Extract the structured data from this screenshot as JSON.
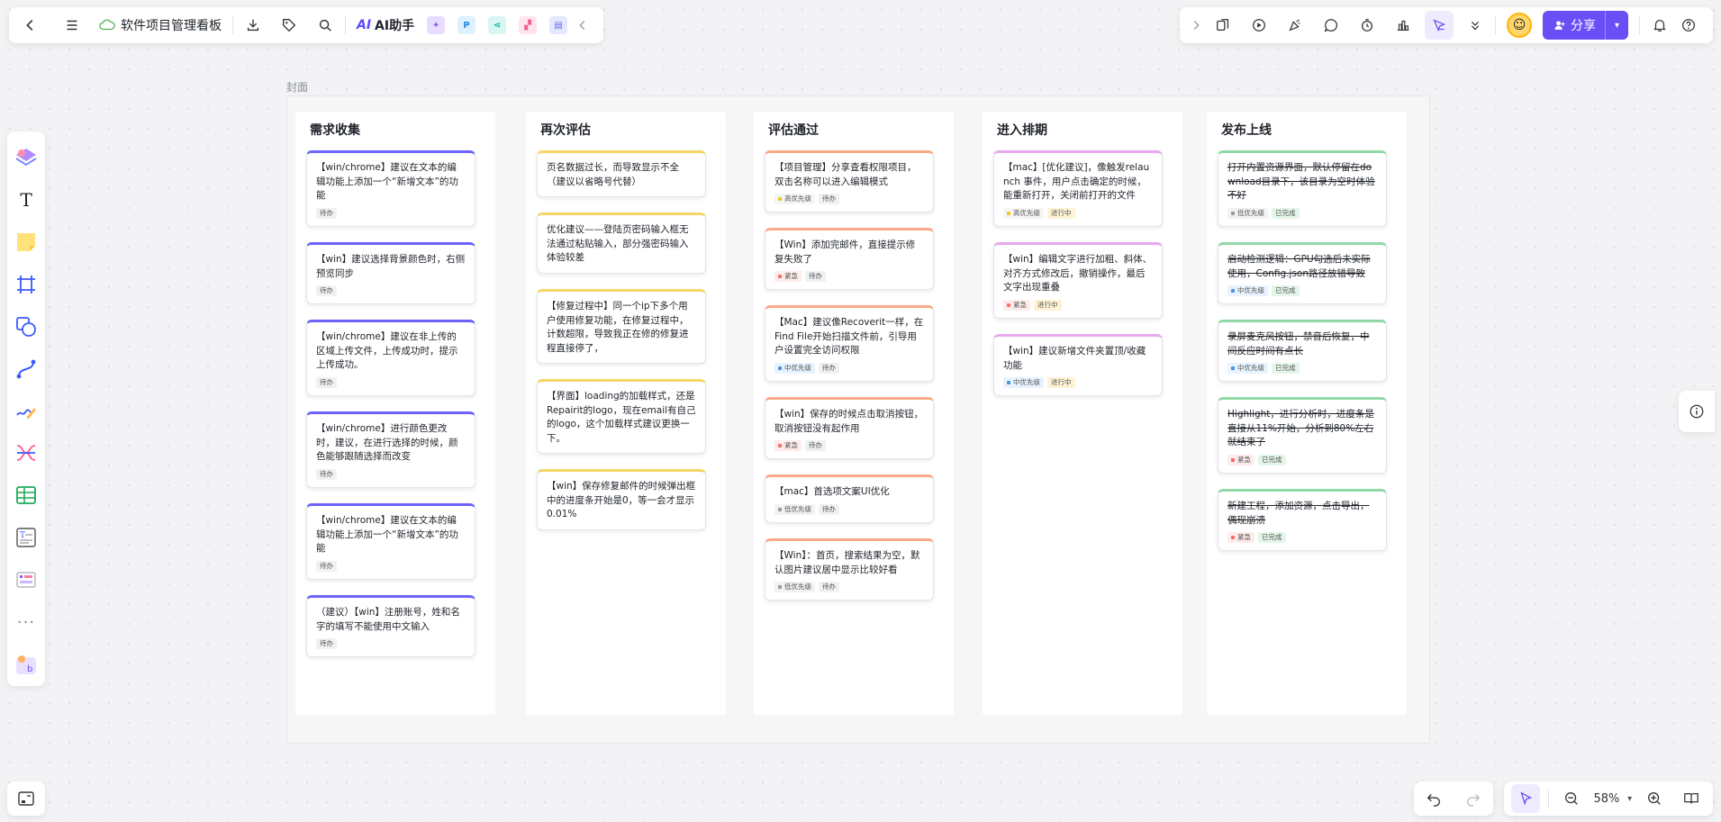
{
  "header": {
    "doc_title": "软件项目管理看板",
    "ai_label": "AI助手",
    "share_label": "分享"
  },
  "canvas": {
    "frame_label": "封面",
    "zoom": "58%"
  },
  "columns": [
    {
      "title": "需求收集",
      "color": "#6c63ff",
      "cards": [
        {
          "text": "【win/chrome】建议在文本的编辑功能上添加一个“新增文本”的功能",
          "tags": [
            {
              "label": "待办"
            }
          ]
        },
        {
          "text": "【win】建议选择背景颜色时，右侧预览同步",
          "tags": [
            {
              "label": "待办"
            }
          ]
        },
        {
          "text": "【win/chrome】建议在非上传的区域上传文件，上传成功时，提示上传成功。",
          "tags": [
            {
              "label": "待办"
            }
          ]
        },
        {
          "text": "【win/chrome】进行颜色更改时，建议，在进行选择的时候，颜色能够跟随选择而改变",
          "tags": [
            {
              "label": "待办"
            }
          ]
        },
        {
          "text": "【win/chrome】建议在文本的编辑功能上添加一个“新增文本”的功能",
          "tags": [
            {
              "label": "待办"
            }
          ]
        },
        {
          "text": "（建议）【win】注册账号，姓和名字的填写不能使用中文输入",
          "tags": [
            {
              "label": "待办"
            }
          ]
        }
      ]
    },
    {
      "title": "再次评估",
      "color": "#f5d565",
      "cards": [
        {
          "text": "页名数据过长，而导致显示不全（建议以省略号代替）",
          "tags": []
        },
        {
          "text": "优化建议——登陆页密码输入框无法通过粘贴输入，部分强密码输入体验较差",
          "tags": []
        },
        {
          "text": "【修复过程中】同一个ip下多个用户使用修复功能，在修复过程中，计数超限，导致我正在修的修复进程直接停了，",
          "tags": []
        },
        {
          "text": "【界面】loading的加载样式，还是Repairit的logo，现在email有自己的logo，这个加载样式建议更换一下。",
          "tags": []
        },
        {
          "text": "【win】保存修复邮件的时候弹出框中的进度条开始是0，等一会才显示0.01%",
          "tags": []
        }
      ]
    },
    {
      "title": "评估通过",
      "color": "#f9a98a",
      "cards": [
        {
          "text": "【项目管理】分享查看权限项目，双击名称可以进入编辑模式",
          "tags": [
            {
              "label": "高优先级",
              "dot": "#f5c518",
              "bg": "#f5f5f5"
            },
            {
              "label": "待办"
            }
          ]
        },
        {
          "text": "【Win】添加完邮件，直接提示修复失败了",
          "tags": [
            {
              "label": "紧急",
              "dot": "#f56c6c",
              "bg": "#fdecea"
            },
            {
              "label": "待办"
            }
          ]
        },
        {
          "text": "【Mac】建议像Recoverit一样，在Find File开始扫描文件前，引导用户设置完全访问权限",
          "tags": [
            {
              "label": "中优先级",
              "dot": "#4a90e2",
              "bg": "#e8f3ff"
            },
            {
              "label": "待办"
            }
          ]
        },
        {
          "text": "【win】保存的时候点击取消按钮，取消按钮没有起作用",
          "tags": [
            {
              "label": "紧急",
              "dot": "#f56c6c",
              "bg": "#fdecea"
            },
            {
              "label": "待办"
            }
          ]
        },
        {
          "text": "【mac】首选项文案UI优化",
          "tags": [
            {
              "label": "低优先级",
              "dot": "#999999",
              "bg": "#f2f2f2"
            },
            {
              "label": "待办"
            }
          ]
        },
        {
          "text": "【Win】：首页，搜索结果为空，默认图片建议居中显示比较好看",
          "tags": [
            {
              "label": "低优先级",
              "dot": "#999999",
              "bg": "#f2f2f2"
            },
            {
              "label": "待办"
            }
          ]
        }
      ]
    },
    {
      "title": "进入排期",
      "color": "#e8a8f0",
      "cards": [
        {
          "text": "【mac】[优化建议]，像触发relaunch 事件，用户点击确定的时候，能重新打开，关闭前打开的文件",
          "tags": [
            {
              "label": "高优先级",
              "dot": "#f5c518",
              "bg": "#f5f5f5"
            },
            {
              "label": "进行中",
              "bg": "#fff3d6"
            }
          ]
        },
        {
          "text": "【win】编辑文字进行加粗、斜体、对齐方式修改后，撤销操作，最后文字出现重叠",
          "tags": [
            {
              "label": "紧急",
              "dot": "#f56c6c",
              "bg": "#fdecea"
            },
            {
              "label": "进行中",
              "bg": "#fff3d6"
            }
          ]
        },
        {
          "text": "【win】建议新增文件夹置顶/收藏功能",
          "tags": [
            {
              "label": "中优先级",
              "dot": "#4a90e2",
              "bg": "#e8f3ff"
            },
            {
              "label": "进行中",
              "bg": "#fff3d6"
            }
          ]
        }
      ]
    },
    {
      "title": "发布上线",
      "color": "#8fd9a8",
      "cards": [
        {
          "text": "打开内置资源界面，默认停留在download目录下，该目录为空时体验不好",
          "done": true,
          "tags": [
            {
              "label": "低优先级",
              "dot": "#999999",
              "bg": "#f2f2f2"
            },
            {
              "label": "已完成",
              "bg": "#e3f6e9"
            }
          ]
        },
        {
          "text": "启动检测逻辑：GPU勾选后未实际使用，Config.json路径放错导致",
          "done": true,
          "tags": [
            {
              "label": "中优先级",
              "dot": "#4a90e2",
              "bg": "#e8f3ff"
            },
            {
              "label": "已完成",
              "bg": "#e3f6e9"
            }
          ]
        },
        {
          "text": "录屏麦克风按钮，禁音后恢复，中间反应时间有点长",
          "done": true,
          "tags": [
            {
              "label": "中优先级",
              "dot": "#4a90e2",
              "bg": "#e8f3ff"
            },
            {
              "label": "已完成",
              "bg": "#e3f6e9"
            }
          ]
        },
        {
          "text": "Highlight，进行分析时，进度条是直接从11%开始，分析到80%左右就结束了",
          "done": true,
          "tags": [
            {
              "label": "紧急",
              "dot": "#f56c6c",
              "bg": "#fdecea"
            },
            {
              "label": "已完成",
              "bg": "#e3f6e9"
            }
          ]
        },
        {
          "text": "新建工程，添加资源，点击导出，偶现崩溃",
          "done": true,
          "tags": [
            {
              "label": "紧急",
              "dot": "#f56c6c",
              "bg": "#fdecea"
            },
            {
              "label": "已完成",
              "bg": "#e3f6e9"
            }
          ]
        }
      ]
    }
  ]
}
